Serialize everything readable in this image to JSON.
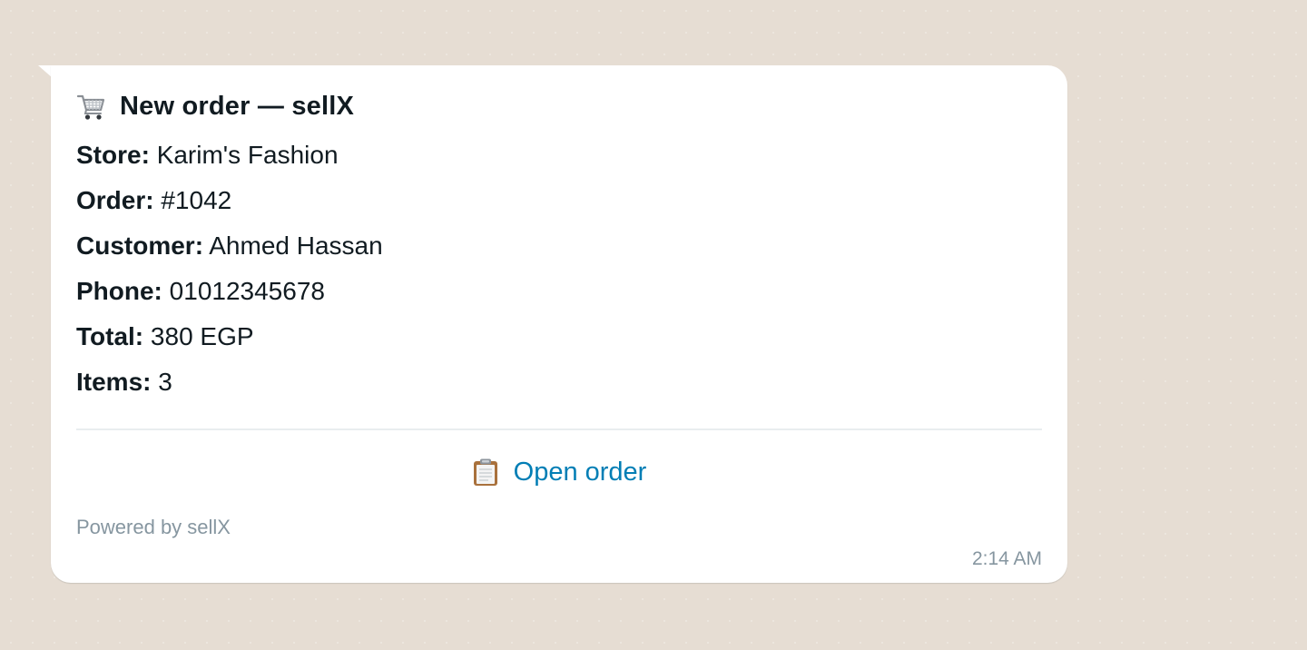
{
  "message": {
    "title": "New order — sellX",
    "title_icon": "shopping-cart-icon",
    "fields": [
      {
        "label": "Store:",
        "value": "Karim's Fashion"
      },
      {
        "label": "Order:",
        "value": "#1042"
      },
      {
        "label": "Customer:",
        "value": "Ahmed Hassan"
      },
      {
        "label": "Phone:",
        "value": "01012345678"
      },
      {
        "label": "Total:",
        "value": "380 EGP"
      },
      {
        "label": "Items:",
        "value": "3"
      }
    ],
    "action": {
      "icon": "clipboard-icon",
      "label": "Open order"
    },
    "footer": "Powered by sellX",
    "timestamp": "2:14 AM"
  },
  "colors": {
    "chat_background": "#e6ddd3",
    "bubble": "#ffffff",
    "link": "#027eb5",
    "muted_text": "#8696a0",
    "primary_text": "#111b21"
  }
}
